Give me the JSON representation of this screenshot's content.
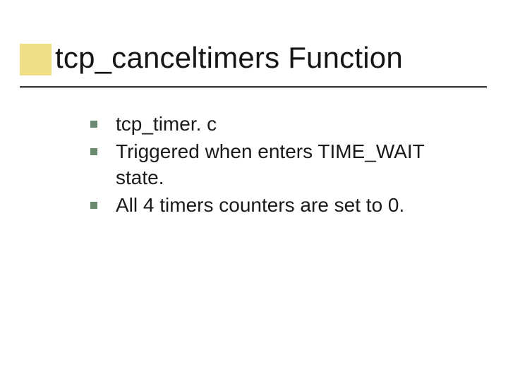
{
  "title": "tcp_canceltimers Function",
  "bullets": [
    "tcp_timer. c",
    "Triggered when enters TIME_WAIT state.",
    "All 4 timers counters are set to 0."
  ]
}
